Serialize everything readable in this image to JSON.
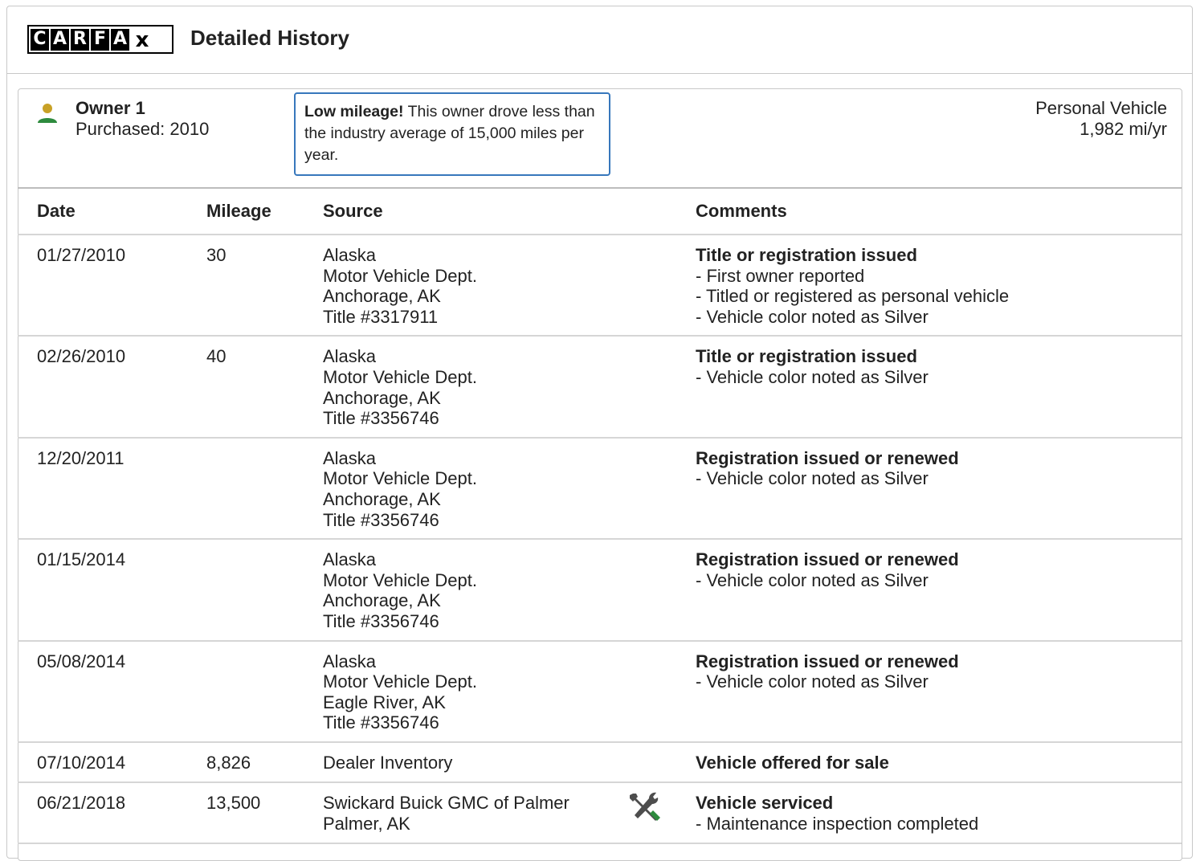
{
  "header": {
    "logo_letters": [
      "C",
      "A",
      "R",
      "F",
      "A"
    ],
    "logo_x": "x",
    "title": "Detailed History"
  },
  "owner": {
    "name": "Owner 1",
    "purchased": "Purchased: 2010",
    "callout_bold": "Low mileage!",
    "callout_text": " This owner drove less than the industry average of 15,000 miles per year.",
    "usage_type": "Personal Vehicle",
    "usage_rate": "1,982 mi/yr"
  },
  "table": {
    "columns": [
      "Date",
      "Mileage",
      "Source",
      "Comments"
    ],
    "rows": [
      {
        "date": "01/27/2010",
        "mileage": "30",
        "source": [
          "Alaska",
          "Motor Vehicle Dept.",
          "Anchorage, AK",
          "Title #3317911"
        ],
        "comment_title": "Title or registration issued",
        "comments": [
          "- First owner reported",
          "- Titled or registered as personal vehicle",
          "- Vehicle color noted as Silver"
        ]
      },
      {
        "date": "02/26/2010",
        "mileage": "40",
        "source": [
          "Alaska",
          "Motor Vehicle Dept.",
          "Anchorage, AK",
          "Title #3356746"
        ],
        "comment_title": "Title or registration issued",
        "comments": [
          "- Vehicle color noted as Silver"
        ]
      },
      {
        "date": "12/20/2011",
        "mileage": "",
        "source": [
          "Alaska",
          "Motor Vehicle Dept.",
          "Anchorage, AK",
          "Title #3356746"
        ],
        "comment_title": "Registration issued or renewed",
        "comments": [
          "- Vehicle color noted as Silver"
        ]
      },
      {
        "date": "01/15/2014",
        "mileage": "",
        "source": [
          "Alaska",
          "Motor Vehicle Dept.",
          "Anchorage, AK",
          "Title #3356746"
        ],
        "comment_title": "Registration issued or renewed",
        "comments": [
          "- Vehicle color noted as Silver"
        ]
      },
      {
        "date": "05/08/2014",
        "mileage": "",
        "source": [
          "Alaska",
          "Motor Vehicle Dept.",
          "Eagle River, AK",
          "Title #3356746"
        ],
        "comment_title": "Registration issued or renewed",
        "comments": [
          "- Vehicle color noted as Silver"
        ]
      },
      {
        "date": "07/10/2014",
        "mileage": "8,826",
        "source": [
          "Dealer Inventory"
        ],
        "comment_title": "Vehicle offered for sale",
        "comments": []
      },
      {
        "date": "06/21/2018",
        "mileage": "13,500",
        "source": [
          "Swickard Buick GMC of Palmer",
          "Palmer, AK"
        ],
        "icon": "wrench-screwdriver-icon",
        "comment_title": "Vehicle serviced",
        "comments": [
          "- Maintenance inspection completed"
        ]
      }
    ]
  },
  "colors": {
    "callout_border": "#3777bc",
    "owner_icon_head": "#c8a126",
    "owner_icon_body": "#2e8b3e",
    "service_icon_green": "#2e8b3e",
    "service_icon_gray": "#4d4d4d"
  }
}
